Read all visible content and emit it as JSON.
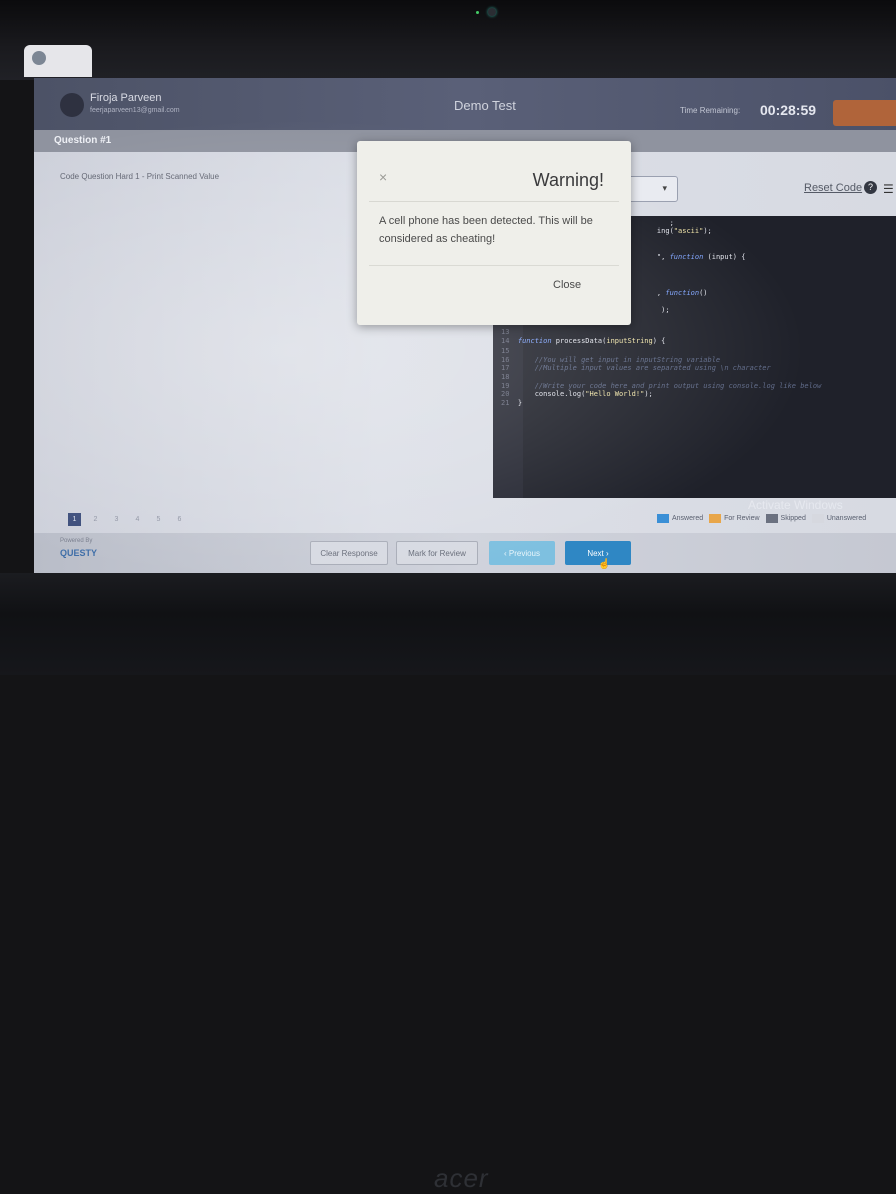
{
  "user": {
    "name": "Firoja Parveen",
    "email": "feerjaparveen13@gmail.com"
  },
  "header": {
    "test_title": "Demo Test",
    "time_label": "Time Remaining:",
    "time_value": "00:28:59",
    "submit_label": ""
  },
  "question": {
    "label": "Question #1",
    "text": "Code Question Hard 1 - Print Scanned Value"
  },
  "editor_toolbar": {
    "reset_label": "Reset Code",
    "help_glyph": "?",
    "menu_glyph": "☰",
    "language_caret": "▾"
  },
  "code_lines": [
    {
      "ln": "",
      "parts": [
        {
          "c": "plain",
          "t": "                                    ;"
        }
      ]
    },
    {
      "ln": "",
      "parts": [
        {
          "c": "plain",
          "t": "                                 ing("
        },
        {
          "c": "str",
          "t": "\"ascii\""
        },
        {
          "c": "plain",
          "t": ");"
        }
      ]
    },
    {
      "ln": "",
      "parts": [
        {
          "c": "plain",
          "t": "                                 \", "
        },
        {
          "c": "kw",
          "t": "function"
        },
        {
          "c": "plain",
          "t": " (input) {"
        }
      ]
    },
    {
      "ln": "",
      "parts": [
        {
          "c": "plain",
          "t": "                                 , "
        },
        {
          "c": "kw",
          "t": "function"
        },
        {
          "c": "plain",
          "t": "()"
        }
      ]
    },
    {
      "ln": "",
      "parts": [
        {
          "c": "plain",
          "t": "                                  );"
        }
      ]
    },
    {
      "ln": "13",
      "parts": []
    },
    {
      "ln": "14",
      "parts": [
        {
          "c": "kw",
          "t": "function"
        },
        {
          "c": "plain",
          "t": " processData("
        },
        {
          "c": "str",
          "t": "inputString"
        },
        {
          "c": "plain",
          "t": ") {"
        }
      ]
    },
    {
      "ln": "15",
      "parts": []
    },
    {
      "ln": "16",
      "parts": [
        {
          "c": "cmt",
          "t": "    //You will get input in inputString variable"
        }
      ]
    },
    {
      "ln": "17",
      "parts": [
        {
          "c": "cmt",
          "t": "    //Multiple input values are separated using \\n character"
        }
      ]
    },
    {
      "ln": "18",
      "parts": []
    },
    {
      "ln": "19",
      "parts": [
        {
          "c": "cmt",
          "t": "    //Write your code here and print output using console.log like below"
        }
      ]
    },
    {
      "ln": "20",
      "parts": [
        {
          "c": "plain",
          "t": "    console.log("
        },
        {
          "c": "str",
          "t": "\"Hello World!\""
        },
        {
          "c": "plain",
          "t": ");"
        }
      ]
    },
    {
      "ln": "21",
      "parts": [
        {
          "c": "plain",
          "t": "}"
        }
      ]
    }
  ],
  "pagination": [
    "1",
    "2",
    "3",
    "4",
    "5",
    "6"
  ],
  "pagination_active": "1",
  "legend": [
    {
      "label": "Answered",
      "color": "#3a8fd6"
    },
    {
      "label": "For Review",
      "color": "#e8a64a"
    },
    {
      "label": "Skipped",
      "color": "#6b7180"
    },
    {
      "label": "Unanswered",
      "color": "#d6d8df"
    }
  ],
  "watermark": "Activate Windows",
  "footer": {
    "powered_by": "Powered By",
    "brand": "QUESTY",
    "clear_label": "Clear Response",
    "mark_label": "Mark for Review",
    "prev_label": "‹ Previous",
    "next_label": "Next ›"
  },
  "modal": {
    "close_x": "×",
    "title": "Warning!",
    "body": "A cell phone has been detected. This will be considered as cheating!",
    "close_label": "Close"
  },
  "laptop": {
    "logo": "acer"
  },
  "colors": {
    "accent_next": "#2f87c4",
    "accent_prev": "#7ec0e0",
    "header_bg": "#4c5266"
  }
}
